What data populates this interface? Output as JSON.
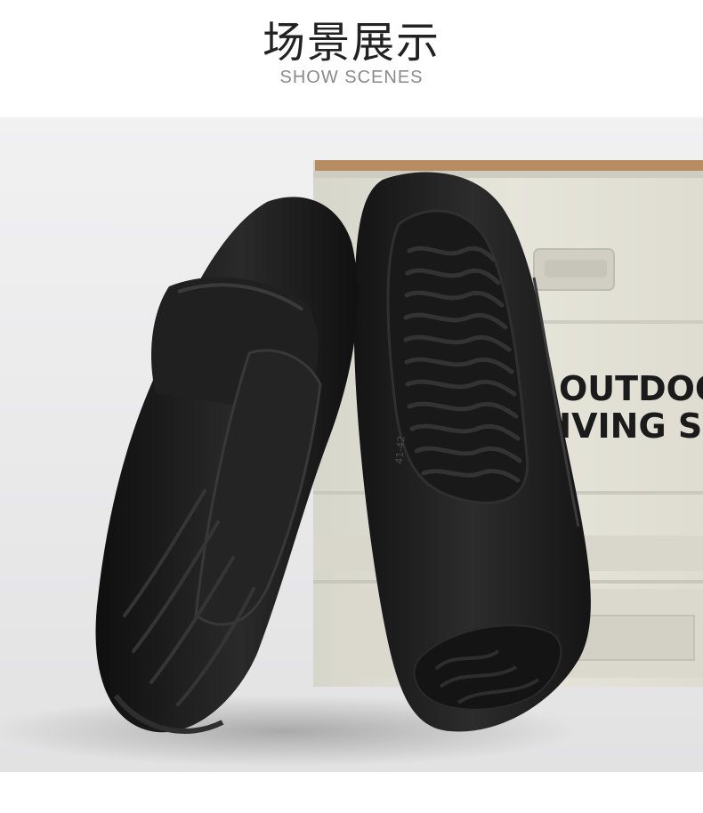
{
  "header": {
    "title_zh": "场景展示",
    "title_en": "SHOW SCENES"
  },
  "scene": {
    "box_text_line1": "OUTDOO",
    "box_text_line2": "IVING S",
    "size_marking": "41-42",
    "colors": {
      "background": "#ececed",
      "storage_box": "#e2e1d6",
      "box_lid_trim": "#b78c62",
      "slipper": "#1b1b1b"
    }
  }
}
